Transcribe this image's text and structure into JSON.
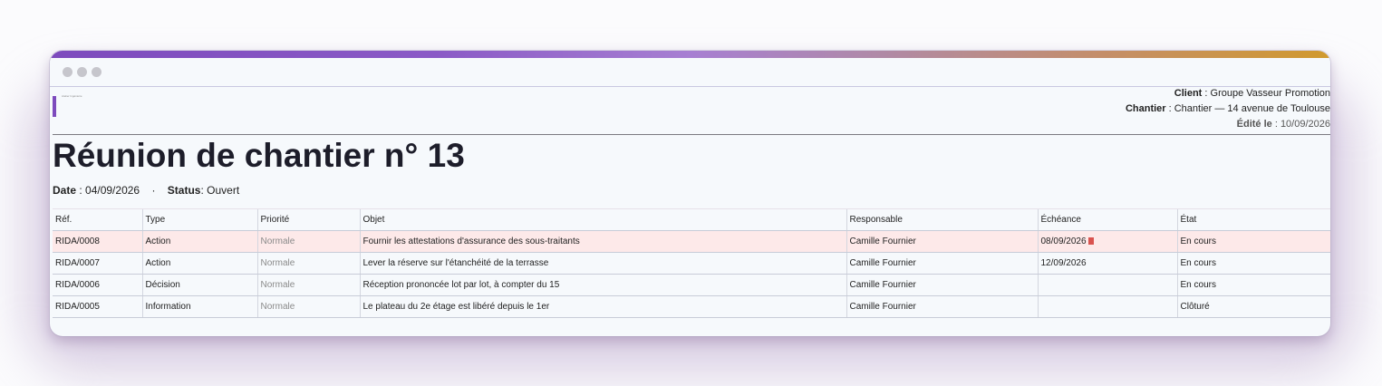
{
  "logo": {
    "text": "Atelier Ingénierie"
  },
  "meta": {
    "client_label": "Client",
    "client_value": "Groupe Vasseur Promotion",
    "chantier_label": "Chantier",
    "chantier_value": "Chantier — 14 avenue de Toulouse",
    "edited_label": "Édité le",
    "edited_value": "10/09/2026"
  },
  "title": "Réunion de chantier n° 13",
  "subline": {
    "date_label": "Date",
    "date_value": "04/09/2026",
    "separator": "·",
    "status_label": "Status",
    "status_value": "Ouvert"
  },
  "table": {
    "columns": [
      "Réf.",
      "Type",
      "Priorité",
      "Objet",
      "Responsable",
      "Échéance",
      "État"
    ],
    "rows": [
      {
        "ref": "RIDA/0008",
        "type": "Action",
        "priority": "Normale",
        "object": "Fournir les attestations d'assurance des sous-traitants",
        "owner": "Camille Fournier",
        "due": "08/09/2026",
        "state": "En cours",
        "overdue": true
      },
      {
        "ref": "RIDA/0007",
        "type": "Action",
        "priority": "Normale",
        "object": "Lever la réserve sur l'étanchéité de la terrasse",
        "owner": "Camille Fournier",
        "due": "12/09/2026",
        "state": "En cours",
        "overdue": false
      },
      {
        "ref": "RIDA/0006",
        "type": "Décision",
        "priority": "Normale",
        "object": "Réception prononcée lot par lot, à compter du 15",
        "owner": "Camille Fournier",
        "due": "",
        "state": "En cours",
        "overdue": false
      },
      {
        "ref": "RIDA/0005",
        "type": "Information",
        "priority": "Normale",
        "object": "Le plateau du 2e étage est libéré depuis le 1er",
        "owner": "Camille Fournier",
        "due": "",
        "state": "Clôturé",
        "overdue": false
      }
    ]
  },
  "colors": {
    "accent": "#7d4bbd",
    "overdue_row": "#fde9e9",
    "overdue_flag": "#d9534f"
  }
}
